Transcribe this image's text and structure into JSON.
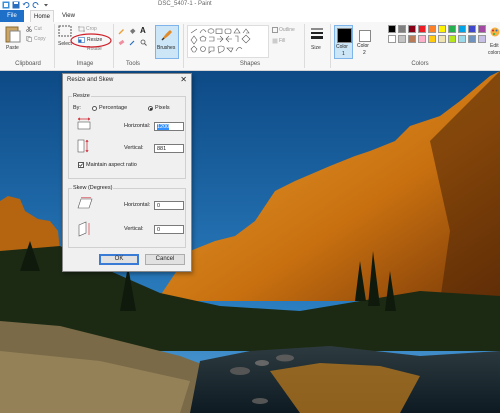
{
  "window": {
    "title": "DSC_5407-1 - Paint"
  },
  "tabs": {
    "file": "File",
    "home": "Home",
    "view": "View"
  },
  "ribbon": {
    "clipboard": {
      "paste": "Paste",
      "cut": "Cut",
      "copy": "Copy",
      "group": "Clipboard"
    },
    "image": {
      "select": "Select",
      "crop": "Crop",
      "resize": "Resize",
      "rotate": "Rotate",
      "group": "Image"
    },
    "tools": {
      "group": "Tools"
    },
    "brushes": {
      "label": "Brushes"
    },
    "shapes": {
      "outline": "Outline",
      "fill": "Fill",
      "group": "Shapes"
    },
    "size": {
      "label": "Size"
    },
    "color1": {
      "label": "Color",
      "sub": "1"
    },
    "color2": {
      "label": "Color",
      "sub": "2"
    },
    "colors": {
      "group": "Colors",
      "edit": "Edit",
      "edit_sub": "colors"
    },
    "palette": [
      "#000000",
      "#7f7f7f",
      "#880015",
      "#ed1c24",
      "#ff7f27",
      "#fff200",
      "#22b14c",
      "#00a2e8",
      "#3f48cc",
      "#a349a4",
      "#ffffff",
      "#c3c3c3",
      "#b97a57",
      "#ffaec9",
      "#ffc90e",
      "#efe4b0",
      "#b5e61d",
      "#99d9ea",
      "#7092be",
      "#c8bfe7"
    ]
  },
  "dialog": {
    "title": "Resize and Skew",
    "close": "✕",
    "resize": {
      "legend": "Resize",
      "by": "By:",
      "percentage": "Percentage",
      "pixels": "Pixels",
      "horizontal_label": "Horizontal:",
      "horizontal_value": "1200",
      "vertical_label": "Vertical:",
      "vertical_value": "881",
      "maintain": "Maintain aspect ratio"
    },
    "skew": {
      "legend": "Skew (Degrees)",
      "horizontal_label": "Horizontal:",
      "horizontal_value": "0",
      "vertical_label": "Vertical:",
      "vertical_value": "0"
    },
    "ok": "OK",
    "cancel": "Cancel"
  }
}
